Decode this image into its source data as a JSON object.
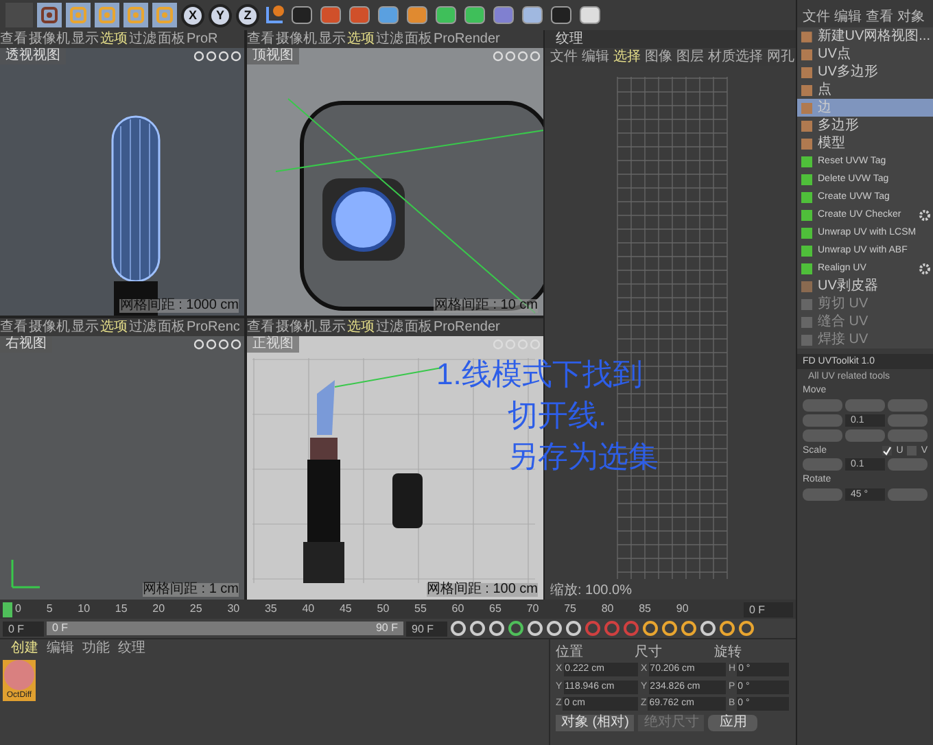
{
  "toolbar": {
    "axis_buttons": [
      {
        "label": "X"
      },
      {
        "label": "Y"
      },
      {
        "label": "Z"
      }
    ]
  },
  "viewports": [
    {
      "kind": "perspective",
      "view_label": "透视视图",
      "grid_spacing": "网格间距 : 1000 cm",
      "menu": [
        {
          "label": "查看",
          "selected": false
        },
        {
          "label": "摄像机",
          "selected": false
        },
        {
          "label": "显示",
          "selected": false
        },
        {
          "label": "选项",
          "selected": true
        },
        {
          "label": "过滤",
          "selected": false
        },
        {
          "label": "面板",
          "selected": false
        },
        {
          "label": "ProR",
          "selected": false
        }
      ]
    },
    {
      "kind": "top",
      "view_label": "顶视图",
      "grid_spacing": "网格间距 : 10 cm",
      "menu": [
        {
          "label": "查看",
          "selected": false
        },
        {
          "label": "摄像机",
          "selected": false
        },
        {
          "label": "显示",
          "selected": false
        },
        {
          "label": "选项",
          "selected": true
        },
        {
          "label": "过滤",
          "selected": false
        },
        {
          "label": "面板",
          "selected": false
        },
        {
          "label": "ProRender",
          "selected": false
        }
      ]
    },
    {
      "kind": "right",
      "view_label": "右视图",
      "grid_spacing": "网格间距 : 1 cm",
      "menu": [
        {
          "label": "查看",
          "selected": false
        },
        {
          "label": "摄像机",
          "selected": false
        },
        {
          "label": "显示",
          "selected": false
        },
        {
          "label": "选项",
          "selected": true
        },
        {
          "label": "过滤",
          "selected": false
        },
        {
          "label": "面板",
          "selected": false
        },
        {
          "label": "ProRenc",
          "selected": false
        }
      ]
    },
    {
      "kind": "front",
      "view_label": "正视图",
      "grid_spacing": "网格间距 : 100 cm",
      "menu": [
        {
          "label": "查看",
          "selected": false
        },
        {
          "label": "摄像机",
          "selected": false
        },
        {
          "label": "显示",
          "selected": false
        },
        {
          "label": "选项",
          "selected": true
        },
        {
          "label": "过滤",
          "selected": false
        },
        {
          "label": "面板",
          "selected": false
        },
        {
          "label": "ProRender",
          "selected": false
        }
      ]
    }
  ],
  "texture_panel": {
    "title": "纹理",
    "menu": [
      {
        "label": "文件",
        "selected": false
      },
      {
        "label": "编辑",
        "selected": false
      },
      {
        "label": "选择",
        "selected": true
      },
      {
        "label": "图像",
        "selected": false
      },
      {
        "label": "图层",
        "selected": false
      },
      {
        "label": "材质选择",
        "selected": false
      },
      {
        "label": "网孔",
        "selected": false
      }
    ],
    "zoom": "缩放: 100.0%"
  },
  "annotation": {
    "lines": [
      "1.线模式下找到",
      "切开线.",
      "另存为选集"
    ]
  },
  "right_panel": {
    "menu": [
      "文件",
      "编辑",
      "查看",
      "对象"
    ],
    "items": [
      {
        "kind": "mode",
        "label": "新建UV网格视图...",
        "selected": false,
        "disabled": false
      },
      {
        "kind": "mode",
        "label": "UV点",
        "selected": false,
        "disabled": false
      },
      {
        "kind": "mode",
        "label": "UV多边形",
        "selected": false,
        "disabled": false
      },
      {
        "kind": "mode",
        "label": "点",
        "selected": false,
        "disabled": false
      },
      {
        "kind": "mode",
        "label": "边",
        "selected": true,
        "disabled": false
      },
      {
        "kind": "mode",
        "label": "多边形",
        "selected": false,
        "disabled": false
      },
      {
        "kind": "mode",
        "label": "模型",
        "selected": false,
        "disabled": false
      },
      {
        "kind": "tool",
        "label": "Reset UVW Tag",
        "selected": false,
        "disabled": false,
        "settings": false
      },
      {
        "kind": "tool",
        "label": "Delete UVW Tag",
        "selected": false,
        "disabled": false,
        "settings": false
      },
      {
        "kind": "tool",
        "label": "Create UVW Tag",
        "selected": false,
        "disabled": false,
        "settings": false
      },
      {
        "kind": "tool",
        "label": "Create UV Checker",
        "selected": false,
        "disabled": false,
        "settings": true
      },
      {
        "kind": "tool",
        "label": "Unwrap UV with LCSM",
        "selected": false,
        "disabled": false,
        "settings": false
      },
      {
        "kind": "tool",
        "label": "Unwrap UV with ABF",
        "selected": false,
        "disabled": false,
        "settings": false
      },
      {
        "kind": "tool",
        "label": "Realign UV",
        "selected": false,
        "disabled": false,
        "settings": true
      },
      {
        "kind": "plugin",
        "label": "UV剥皮器",
        "selected": false,
        "disabled": false
      },
      {
        "kind": "plugin",
        "label": "剪切 UV",
        "selected": false,
        "disabled": true
      },
      {
        "kind": "plugin",
        "label": "缝合 UV",
        "selected": false,
        "disabled": true
      },
      {
        "kind": "plugin",
        "label": "焊接 UV",
        "selected": false,
        "disabled": true
      }
    ]
  },
  "uv_toolkit": {
    "title": "FD UVToolkit 1.0",
    "subtitle": "All UV related tools",
    "move_label": "Move",
    "move_value": "0.1",
    "scale_label": "Scale",
    "scale_u": {
      "label": "U",
      "checked": true
    },
    "scale_v": {
      "label": "V",
      "checked": false
    },
    "scale_value": "0.1",
    "rotate_label": "Rotate",
    "rotate_value": "45 °"
  },
  "timeline": {
    "ticks": [
      "0",
      "5",
      "10",
      "15",
      "20",
      "25",
      "30",
      "35",
      "40",
      "45",
      "50",
      "55",
      "60",
      "65",
      "70",
      "75",
      "80",
      "85",
      "90"
    ],
    "current": "0 F",
    "start": "0 F",
    "range": {
      "start": "0 F",
      "end": "90 F",
      "level": 1
    },
    "end": "90 F"
  },
  "materials": {
    "menu": [
      {
        "label": "创建",
        "selected": true
      },
      {
        "label": "编辑",
        "selected": false
      },
      {
        "label": "功能",
        "selected": false
      },
      {
        "label": "纹理",
        "selected": false
      }
    ],
    "items": [
      {
        "name": "OctDiff",
        "selected": true
      }
    ]
  },
  "coordinates": {
    "headers": [
      "位置",
      "尺寸",
      "旋转"
    ],
    "rows": [
      [
        {
          "axis": "X",
          "value": "0.222 cm"
        },
        {
          "axis": "X",
          "value": "70.206 cm"
        },
        {
          "axis": "H",
          "value": "0 °"
        }
      ],
      [
        {
          "axis": "Y",
          "value": "118.946 cm"
        },
        {
          "axis": "Y",
          "value": "234.826 cm"
        },
        {
          "axis": "P",
          "value": "0 °"
        }
      ],
      [
        {
          "axis": "Z",
          "value": "0 cm"
        },
        {
          "axis": "Z",
          "value": "69.762 cm"
        },
        {
          "axis": "B",
          "value": "0 °"
        }
      ]
    ],
    "mode_dropdown": "对象 (相对)",
    "size_dropdown": {
      "label": "绝对尺寸",
      "disabled": true
    },
    "apply": "应用"
  }
}
